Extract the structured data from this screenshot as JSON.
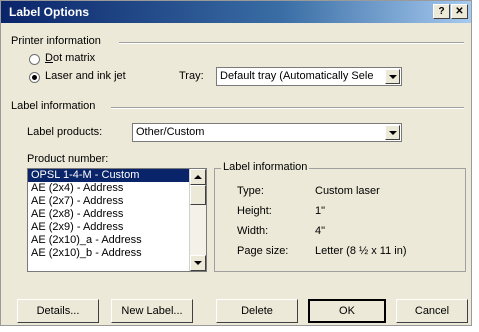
{
  "window": {
    "title": "Label Options",
    "help_glyph": "?",
    "close_glyph": "✕"
  },
  "printer": {
    "section_title": "Printer information",
    "dot_matrix": "Dot matrix",
    "laser": "Laser and ink jet",
    "selected": "laser",
    "tray_label": "Tray:",
    "tray_value": "Default tray (Automatically Sele"
  },
  "label_info": {
    "section_title": "Label information",
    "products_label": "Label products:",
    "products_value": "Other/Custom"
  },
  "products": {
    "label": "Product number:",
    "items": [
      "OPSL 1-4-M - Custom",
      "AE (2x4) - Address",
      "AE (2x7) - Address",
      "AE (2x8) - Address",
      "AE (2x9) - Address",
      "AE (2x10)_a - Address",
      "AE (2x10)_b - Address"
    ],
    "selected_index": 0
  },
  "details": {
    "title": "Label information",
    "type_label": "Type:",
    "type_value": "Custom laser",
    "height_label": "Height:",
    "height_value": "1\"",
    "width_label": "Width:",
    "width_value": "4\"",
    "pagesize_label": "Page size:",
    "pagesize_value": "Letter (8 ½ x 11 in)"
  },
  "buttons": {
    "details": "Details...",
    "new_label": "New Label...",
    "delete": "Delete",
    "ok": "OK",
    "cancel": "Cancel"
  }
}
